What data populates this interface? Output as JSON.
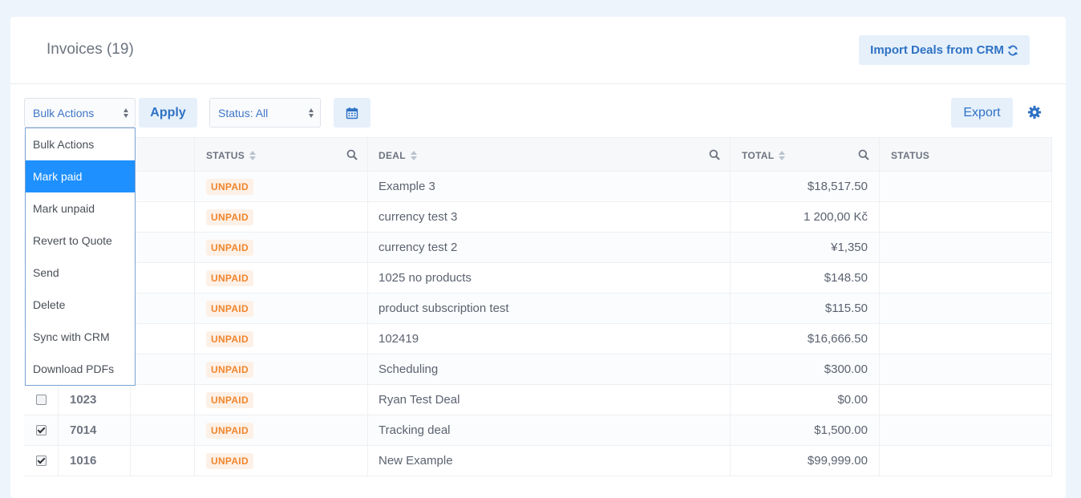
{
  "header": {
    "title": "Invoices (19)",
    "import_label": "Import Deals from CRM"
  },
  "toolbar": {
    "bulk_label": "Bulk Actions",
    "apply_label": "Apply",
    "status_label": "Status: All",
    "export_label": "Export"
  },
  "icons": {
    "import": "refresh-icon",
    "calendar": "calendar-icon",
    "settings": "gear-icon",
    "search": "search-icon"
  },
  "colors": {
    "accent": "#2e72c4",
    "selected": "#1e90ff",
    "unpaid": "#f0852d"
  },
  "table": {
    "headers": {
      "status": "STATUS",
      "deal": "DEAL",
      "total": "TOTAL",
      "status2": "STATUS"
    },
    "rows": [
      {
        "number": "",
        "checked": false,
        "status": "UNPAID",
        "deal": "Example 3",
        "total": "$18,517.50"
      },
      {
        "number": "",
        "checked": false,
        "status": "UNPAID",
        "deal": "currency test 3",
        "total": "1 200,00 Kč"
      },
      {
        "number": "",
        "checked": false,
        "status": "UNPAID",
        "deal": "currency test 2",
        "total": "¥1,350"
      },
      {
        "number": "",
        "checked": false,
        "status": "UNPAID",
        "deal": "1025 no products",
        "total": "$148.50"
      },
      {
        "number": "",
        "checked": false,
        "status": "UNPAID",
        "deal": "product subscription test",
        "total": "$115.50"
      },
      {
        "number": "",
        "checked": false,
        "status": "UNPAID",
        "deal": "102419",
        "total": "$16,666.50"
      },
      {
        "number": "",
        "checked": false,
        "status": "UNPAID",
        "deal": "Scheduling",
        "total": "$300.00"
      },
      {
        "number": "1023",
        "checked": false,
        "status": "UNPAID",
        "deal": "Ryan Test Deal",
        "total": "$0.00"
      },
      {
        "number": "7014",
        "checked": true,
        "status": "UNPAID",
        "deal": "Tracking deal",
        "total": "$1,500.00"
      },
      {
        "number": "1016",
        "checked": true,
        "status": "UNPAID",
        "deal": "New Example",
        "total": "$99,999.00"
      }
    ]
  },
  "bulk_menu": {
    "selected": "Mark paid",
    "items": [
      "Bulk Actions",
      "Mark paid",
      "Mark unpaid",
      "Revert to Quote",
      "Send",
      "Delete",
      "Sync with CRM",
      "Download PDFs"
    ]
  }
}
